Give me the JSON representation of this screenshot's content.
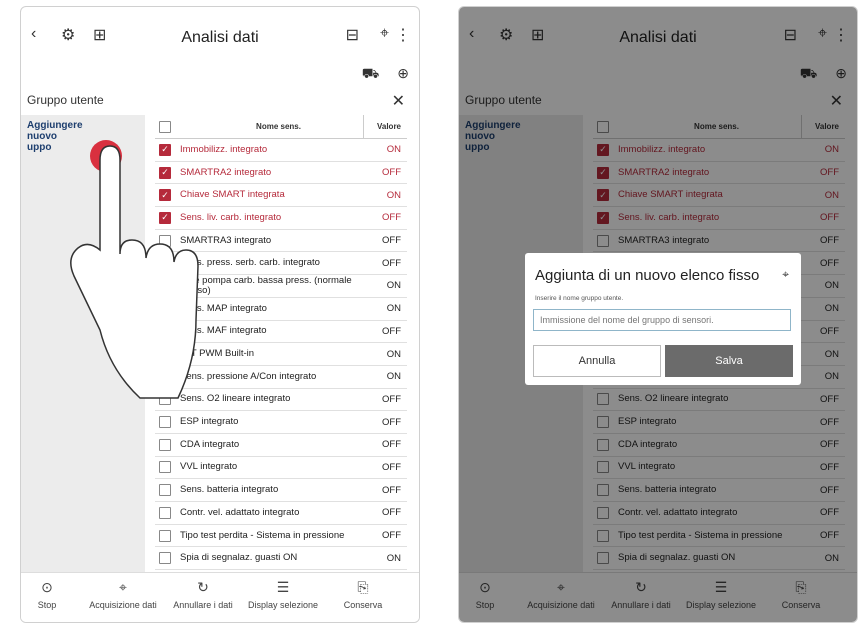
{
  "header": {
    "title": "Analisi dati",
    "back_icon": "back-arrow-icon",
    "title_icon_1": "sensor-icon",
    "title_icon_2": "add-vehicle-icon",
    "more_icon": "more-vertical-icon"
  },
  "subheader_icons": [
    "vehicle-icon",
    "speedometer-icon"
  ],
  "group": {
    "header": "Gruppo utente",
    "add_new": "Aggiungere nuovo\nuppo",
    "add_new_right": "Aggiungere nuovo\nuppo"
  },
  "table": {
    "col_name": "Nome sens.",
    "col_value": "Valore",
    "rows": [
      {
        "name": "Immobilizz. integrato",
        "value": "ON",
        "checked": true
      },
      {
        "name": "SMARTRA2 integrato",
        "value": "OFF",
        "checked": true
      },
      {
        "name": "Chiave SMART integrata",
        "value": "ON",
        "checked": true
      },
      {
        "name": "Sens. liv. carb. integrato",
        "value": "OFF",
        "checked": true
      },
      {
        "name": "SMARTRA3 integrato",
        "value": "OFF",
        "checked": false
      },
      {
        "name": "Sens. press. serb. carb. integrato",
        "value": "OFF",
        "checked": false
      },
      {
        "name": "Relè pompa carb. bassa press. (normale chiuso)",
        "value": "ON",
        "checked": false
      },
      {
        "name": "Sens. MAP integrato",
        "value": "ON",
        "checked": false
      },
      {
        "name": "Sens. MAF integrato",
        "value": "OFF",
        "checked": false
      },
      {
        "name": "ALT PWM Built-in",
        "value": "ON",
        "checked": false
      },
      {
        "name": "Sens. pressione A/Con integrato",
        "value": "ON",
        "checked": false
      },
      {
        "name": "Sens. O2 lineare integrato",
        "value": "OFF",
        "checked": false
      },
      {
        "name": "ESP integrato",
        "value": "OFF",
        "checked": false
      },
      {
        "name": "CDA integrato",
        "value": "OFF",
        "checked": false
      },
      {
        "name": "VVL integrato",
        "value": "OFF",
        "checked": false
      },
      {
        "name": "Sens. batteria integrato",
        "value": "OFF",
        "checked": false
      },
      {
        "name": "Contr. vel. adattato integrato",
        "value": "OFF",
        "checked": false
      },
      {
        "name": "Tipo test perdita - Sistema in pressione",
        "value": "OFF",
        "checked": false
      },
      {
        "name": "Spia di segnalaz. guasti ON",
        "value": "ON",
        "checked": false
      }
    ]
  },
  "bottombar": {
    "items": [
      "Stop",
      "Acquisizione dati",
      "Annullare i dati",
      "Display selezione",
      "Conserva"
    ]
  },
  "dialog": {
    "title": "Aggiunta di un nuovo elenco fisso",
    "label": "Inserire il nome gruppo utente.",
    "placeholder": "Immissione del nome del gruppo di sensori.",
    "cancel": "Annulla",
    "save": "Salva"
  },
  "colors": {
    "accent_red": "#b52a3b",
    "link_blue": "#1d3e6e",
    "save_gray": "#6b6b6b"
  }
}
